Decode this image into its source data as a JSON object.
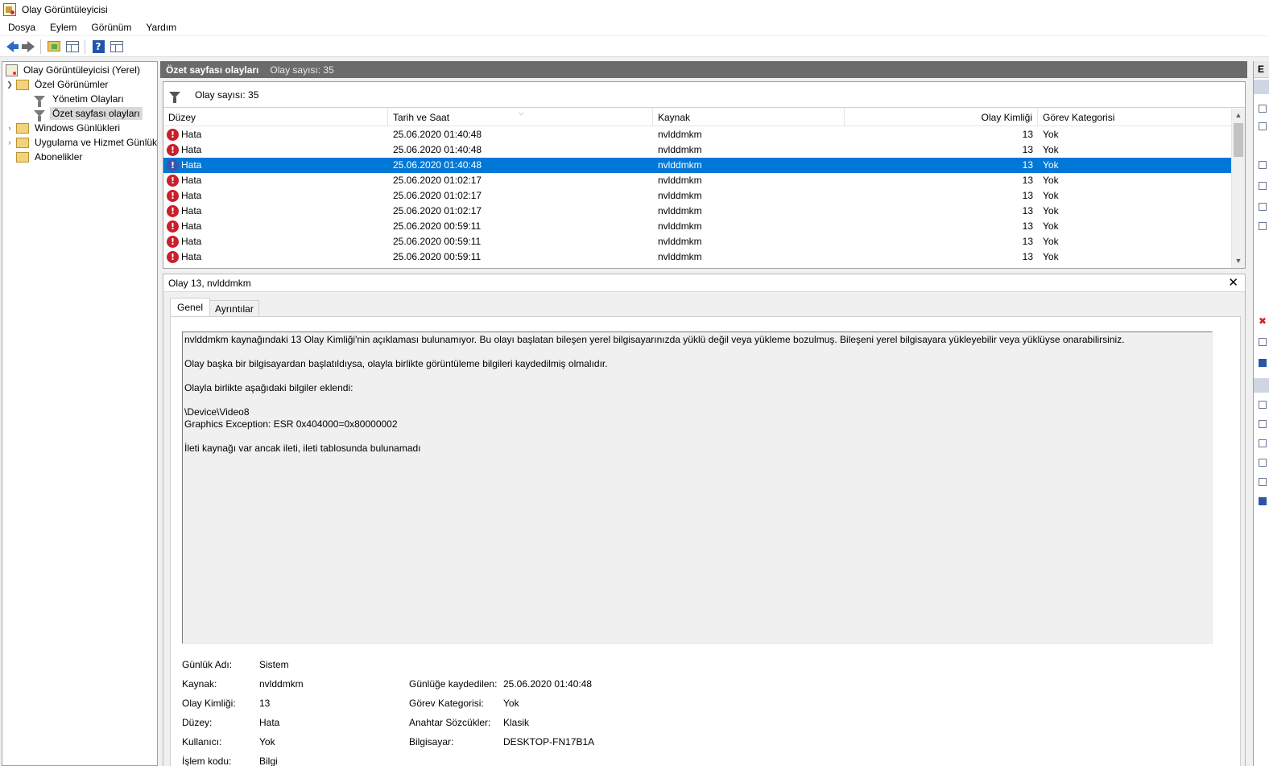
{
  "window": {
    "title": "Olay Görüntüleyicisi"
  },
  "menu": [
    "Dosya",
    "Eylem",
    "Görünüm",
    "Yardım"
  ],
  "toolbar": {
    "help_glyph": "?"
  },
  "tree": {
    "root": "Olay Görüntüleyicisi (Yerel)",
    "custom_views": "Özel Görünümler",
    "admin_events": "Yönetim Olayları",
    "summary_events": "Özet sayfası olayları",
    "windows_logs": "Windows Günlükleri",
    "app_service_logs": "Uygulama ve Hizmet Günlükleri",
    "subscriptions": "Abonelikler"
  },
  "header": {
    "title": "Özet sayfası olayları",
    "count": "Olay sayısı: 35"
  },
  "filter": {
    "count": "Olay sayısı: 35"
  },
  "columns": {
    "level": "Düzey",
    "datetime": "Tarih ve Saat",
    "source": "Kaynak",
    "event_id": "Olay Kimliği",
    "category": "Görev Kategorisi"
  },
  "events": [
    {
      "level": "Hata",
      "datetime": "25.06.2020 01:40:48",
      "source": "nvlddmkm",
      "event_id": "13",
      "category": "Yok"
    },
    {
      "level": "Hata",
      "datetime": "25.06.2020 01:40:48",
      "source": "nvlddmkm",
      "event_id": "13",
      "category": "Yok"
    },
    {
      "level": "Hata",
      "datetime": "25.06.2020 01:40:48",
      "source": "nvlddmkm",
      "event_id": "13",
      "category": "Yok",
      "selected": true
    },
    {
      "level": "Hata",
      "datetime": "25.06.2020 01:02:17",
      "source": "nvlddmkm",
      "event_id": "13",
      "category": "Yok"
    },
    {
      "level": "Hata",
      "datetime": "25.06.2020 01:02:17",
      "source": "nvlddmkm",
      "event_id": "13",
      "category": "Yok"
    },
    {
      "level": "Hata",
      "datetime": "25.06.2020 01:02:17",
      "source": "nvlddmkm",
      "event_id": "13",
      "category": "Yok"
    },
    {
      "level": "Hata",
      "datetime": "25.06.2020 00:59:11",
      "source": "nvlddmkm",
      "event_id": "13",
      "category": "Yok"
    },
    {
      "level": "Hata",
      "datetime": "25.06.2020 00:59:11",
      "source": "nvlddmkm",
      "event_id": "13",
      "category": "Yok"
    },
    {
      "level": "Hata",
      "datetime": "25.06.2020 00:59:11",
      "source": "nvlddmkm",
      "event_id": "13",
      "category": "Yok"
    }
  ],
  "detail": {
    "title": "Olay 13, nvlddmkm",
    "close_glyph": "✕",
    "tabs": {
      "general": "Genel",
      "details": "Ayrıntılar"
    },
    "description": {
      "line1": "nvlddmkm kaynağındaki 13 Olay Kimliği'nin açıklaması bulunamıyor. Bu olayı başlatan bileşen yerel bilgisayarınızda yüklü değil veya yükleme bozulmuş. Bileşeni yerel bilgisayara yükleyebilir veya yüklüyse onarabilirsiniz.",
      "line2": "Olay başka bir bilgisayardan başlatıldıysa, olayla birlikte görüntüleme bilgileri kaydedilmiş olmalıdır.",
      "line3": "Olayla birlikte aşağıdaki bilgiler eklendi:",
      "line4": "\\Device\\Video8",
      "line5": "Graphics Exception: ESR 0x404000=0x80000002",
      "line6": "İleti kaynağı var ancak ileti, ileti tablosunda bulunamadı"
    },
    "props": {
      "log_name_label": "Günlük Adı:",
      "log_name": "Sistem",
      "source_label": "Kaynak:",
      "source": "nvlddmkm",
      "logged_label": "Günlüğe kaydedilen:",
      "logged": "25.06.2020 01:40:48",
      "event_id_label": "Olay Kimliği:",
      "event_id": "13",
      "category_label": "Görev Kategorisi:",
      "category": "Yok",
      "level_label": "Düzey:",
      "level": "Hata",
      "keywords_label": "Anahtar Sözcükler:",
      "keywords": "Klasik",
      "user_label": "Kullanıcı:",
      "user": "Yok",
      "computer_label": "Bilgisayar:",
      "computer": "DESKTOP-FN17B1A",
      "opcode_label": "İşlem kodu:",
      "opcode": "Bilgi"
    }
  },
  "actions": {
    "header": "E"
  }
}
